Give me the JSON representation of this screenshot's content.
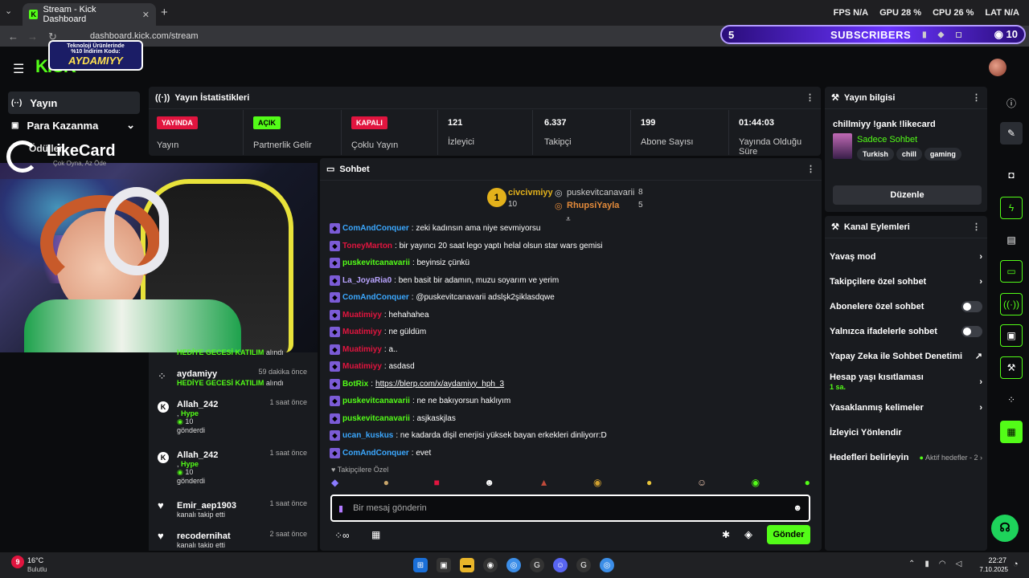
{
  "browser": {
    "tab_title": "Stream - Kick Dashboard",
    "url": "dashboard.kick.com/stream",
    "overlay_stats": [
      {
        "label": "FPS",
        "value": "N/A"
      },
      {
        "label": "GPU",
        "value": "28 %"
      },
      {
        "label": "CPU",
        "value": "26 %"
      },
      {
        "label": "LAT",
        "value": "N/A"
      }
    ]
  },
  "subscriber_banner": {
    "count": "5",
    "label": "SUBSCRIBERS",
    "viewers": "10"
  },
  "promo": {
    "line1": "Teknoloji Ürünlerinde",
    "line2": "%10 İndirim Kodu:",
    "code": "AYDAMIYY"
  },
  "brand": {
    "logo": "KICK",
    "likecard": "LikeCard",
    "likecard_sub": "Çok Oyna, Az Öde"
  },
  "sidebar": {
    "items": [
      {
        "label": "Yayın",
        "icon": "(··)"
      },
      {
        "label": "Para Kazanma",
        "icon": "▣"
      }
    ],
    "partial_label": "Ödüller"
  },
  "stats_panel": {
    "title": "Yayın İstatistikleri",
    "cells": [
      {
        "badge": "YAYINDA",
        "label": "Yayın"
      },
      {
        "badge": "AÇIK",
        "label": "Partnerlik Gelir"
      },
      {
        "badge": "KAPALI",
        "label": "Çoklu Yayın"
      },
      {
        "value": "121",
        "label": "İzleyici"
      },
      {
        "value": "6.337",
        "label": "Takipçi"
      },
      {
        "value": "199",
        "label": "Abone Sayısı"
      },
      {
        "value": "01:44:03",
        "label": "Yayında Olduğu Süre"
      }
    ],
    "colors": {
      "live": "#e1153f",
      "on": "#53fc18",
      "off": "#e1153f"
    }
  },
  "activity": {
    "items": [
      {
        "name": "",
        "time": "",
        "line1": "HEDİYE GECESİ KATILIM",
        "line2": "alındı"
      },
      {
        "name": "aydamiyy",
        "time": "59 dakika önce",
        "line1": "HEDİYE GECESİ KATILIM",
        "line2": "alındı"
      },
      {
        "name": "Allah_242",
        "time": "1 saat önce",
        "line1": "Hype",
        "amount": "10",
        "line2": "gönderdi"
      },
      {
        "name": "Allah_242",
        "time": "1 saat önce",
        "line1": "Hype",
        "amount": "10",
        "line2": "gönderdi"
      },
      {
        "name": "Emir_aep1903",
        "time": "1 saat önce",
        "line2": "kanalı takip etti"
      },
      {
        "name": "recodernihat",
        "time": "2 saat önce",
        "line2": "kanalı takip etti"
      }
    ]
  },
  "chat": {
    "title": "Sohbet",
    "leaderboard": {
      "first": {
        "name": "civcivmiyy",
        "count": "10"
      },
      "second": {
        "name": "puskevitcanavarii",
        "count": "8"
      },
      "third": {
        "name": "RhupsiYayla",
        "count": "5"
      }
    },
    "messages": [
      {
        "user": "ComAndConquer",
        "color": "#3ba8ff",
        "text": ": zeki kadınsın ama niye sevmiyorsu"
      },
      {
        "user": "ToneyMarton",
        "color": "#e1153f",
        "text": ": bir yayıncı 20 saat lego yaptı helal olsun star wars gemisi"
      },
      {
        "user": "puskevitcanavarii",
        "color": "#53fc18",
        "text": ": beyinsiz çünkü"
      },
      {
        "user": "La_JoyaRia0",
        "color": "#b9a4ff",
        "text": ": ben basit bir adamın, muzu soyarım ve yerim"
      },
      {
        "user": "ComAndConquer",
        "color": "#3ba8ff",
        "text": ": @puskevitcanavarii adslşk2şiklasdqwe"
      },
      {
        "user": "Muatimiyy",
        "color": "#e1153f",
        "text": ": hehahahea"
      },
      {
        "user": "Muatimiyy",
        "color": "#e1153f",
        "text": ": ne güldüm"
      },
      {
        "user": "Muatimiyy",
        "color": "#e1153f",
        "text": ": a.."
      },
      {
        "user": "Muatimiyy",
        "color": "#e1153f",
        "text": ": asdasd"
      },
      {
        "user": "BotRix",
        "color": "#53fc18",
        "text": ": ",
        "link": "https://blerp.com/x/aydamiyy_hph_3"
      },
      {
        "user": "puskevitcanavarii",
        "color": "#53fc18",
        "text": ": ne ne bakıyorsun haklıyım"
      },
      {
        "user": "puskevitcanavarii",
        "color": "#53fc18",
        "text": ": asjkaskjlas"
      },
      {
        "user": "ucan_kuskus",
        "color": "#3ba8ff",
        "text": ": ne kadarda dişil enerjisi yüksek bayan erkekleri dinliyorr:D"
      },
      {
        "user": "ComAndConquer",
        "color": "#3ba8ff",
        "text": ": evet"
      }
    ],
    "followers_only_label": "Takipçilere Özel",
    "input_placeholder": "Bir mesaj gönderin",
    "send_label": "Gönder"
  },
  "stream_info": {
    "title_label": "Yayın bilgisi",
    "stream_title": "chillmiyy !gank !likecard",
    "category": "Sadece Sohbet",
    "tags": [
      "Turkish",
      "chill",
      "gaming"
    ],
    "edit_label": "Düzenle"
  },
  "channel_actions": {
    "title": "Kanal Eylemleri",
    "items": [
      {
        "label": "Yavaş mod",
        "control": "chevron"
      },
      {
        "label": "Takipçilere özel sohbet",
        "control": "chevron"
      },
      {
        "label": "Abonelere özel sohbet",
        "control": "toggle"
      },
      {
        "label": "Yalnızca ifadelerle sohbet",
        "control": "toggle"
      },
      {
        "label": "Yapay Zeka ile Sohbet Denetimi",
        "control": "external"
      },
      {
        "label": "Hesap yaşı kısıtlaması",
        "sub": "1 sa.",
        "control": "chevron"
      },
      {
        "label": "Yasaklanmış kelimeler",
        "control": "chevron"
      },
      {
        "label": "İzleyici Yönlendir",
        "control": "none"
      },
      {
        "label": "Hedefleri belirleyin",
        "extra": "Aktif hedefler - 2",
        "control": "chevron"
      }
    ]
  },
  "taskbar": {
    "weather_temp": "16°C",
    "weather_desc": "Bulutlu",
    "weather_badge": "9",
    "time": "22:27",
    "date": "7.10.2025"
  }
}
